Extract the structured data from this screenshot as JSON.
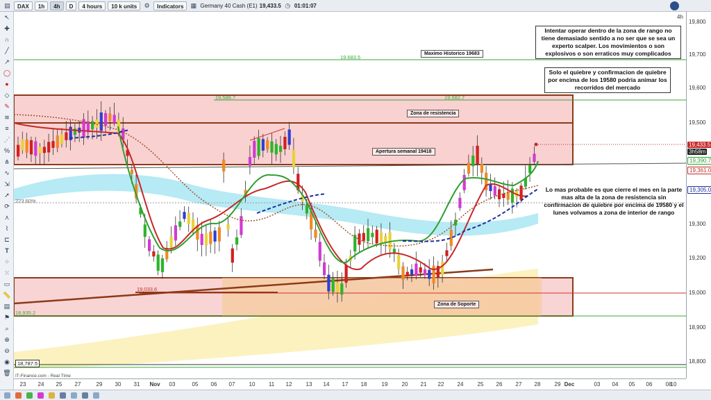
{
  "toolbar": {
    "symbol": "DAX",
    "timeframes": [
      "1h",
      "4h",
      "D"
    ],
    "active_timeframe": "4h",
    "interval": "4 hours",
    "size": "10 k units",
    "indicators_label": "Indicators",
    "instrument": "Germany 40 Cash (E1)",
    "last_price": "19,433.5",
    "countdown": "01:01:07"
  },
  "axis": {
    "timeframe_marker": "4h",
    "price_labels": [
      "19,800",
      "19,700",
      "19,600",
      "19,500",
      "19,400",
      "19,300",
      "19,200",
      "19,100",
      "19,000",
      "18,900",
      "18,800"
    ],
    "price_tags": {
      "current": "19,433.5",
      "timer": "3h58m",
      "ma_green": "19,390.7",
      "ma_red": "19,361.0",
      "ma_blue": "19,305.0"
    },
    "time_labels": [
      "23",
      "24",
      "25",
      "27",
      "29",
      "30",
      "31",
      "Nov",
      "03",
      "05",
      "06",
      "07",
      "10",
      "11",
      "12",
      "13",
      "14",
      "17",
      "18",
      "19",
      "20",
      "21",
      "22",
      "24",
      "25",
      "26",
      "27",
      "28",
      "29",
      "Dec",
      "03",
      "04",
      "05",
      "06",
      "08",
      "10"
    ]
  },
  "levels": {
    "max_hist": "19,683.5",
    "r1": "19,586.7",
    "r2": "19,582.7",
    "low": "19,033.6",
    "pct": "223.60%",
    "low2": "18,935.2",
    "low3": "18,787.5"
  },
  "labels": {
    "max_hist": "Maximo Historico 19683",
    "resistance_zone": "Zona de resistencia",
    "weekly_open": "Apertura semanal 19418",
    "support_zone": "Zona de Soporte"
  },
  "notes": {
    "note1": "Intentar operar dentro de la zona de rango no tiene demasiado sentido a no ser que se sea un experto scalper. Los movimientos o son explosivos o son erraticos muy complicados",
    "note2": "Solo el quiebre y confirmacion de quiebre por encima de los 19580 podria animar los recorridos del mercado",
    "note3": "Lo mas probable es que cierre el mes en la parte mas alta de la zona de resistencia sin confirmacion de quiebre por encima de 19580 y el lunes volvamos a zona de interior de rango"
  },
  "source": "IT-Finance.com - Real Time",
  "colors": {
    "zone_fill": "#f8c9c9",
    "zone_border": "#8b3a1a",
    "bull": "#2bb52b",
    "bear": "#d22020",
    "magenta": "#d23ad2",
    "blue": "#2f3fd0",
    "orange": "#f08a24",
    "yellow": "#e8d23a",
    "cyan_band": "#a9e6f2",
    "yellow_band": "#fbf2c0",
    "green_line": "#4caf50",
    "red_line": "#d32f2f",
    "navy_dash": "#1d2f9e"
  }
}
